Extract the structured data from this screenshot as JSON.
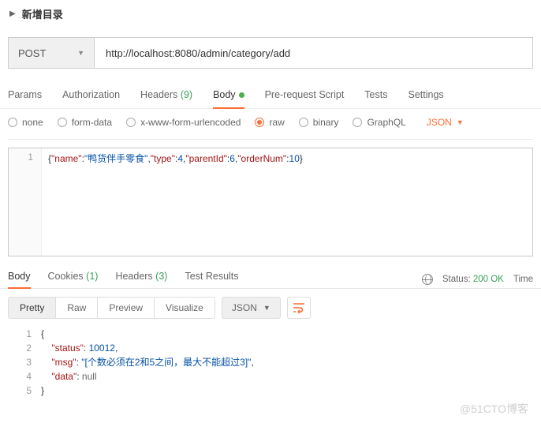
{
  "collapse": {
    "title": "新增目录"
  },
  "req": {
    "method": "POST",
    "url": "http://localhost:8080/admin/category/add"
  },
  "tabs": {
    "params": "Params",
    "auth": "Authorization",
    "headers_label": "Headers",
    "headers_count": "(9)",
    "body": "Body",
    "prereq": "Pre-request Script",
    "tests": "Tests",
    "settings": "Settings"
  },
  "bodytype": {
    "none": "none",
    "formdata": "form-data",
    "xwww": "x-www-form-urlencoded",
    "raw": "raw",
    "binary": "binary",
    "graphql": "GraphQL",
    "json": "JSON"
  },
  "reqbody": {
    "line_no": "1",
    "k_name": "\"name\"",
    "v_name": "\"鸭货伴手零食\"",
    "k_type": "\"type\"",
    "v_type": "4",
    "k_parent": "\"parentId\"",
    "v_parent": "6",
    "k_order": "\"orderNum\"",
    "v_order": "10"
  },
  "resptabs": {
    "body": "Body",
    "cookies_label": "Cookies",
    "cookies_count": "(1)",
    "headers_label": "Headers",
    "headers_count": "(3)",
    "tests": "Test Results"
  },
  "status": {
    "label": "Status:",
    "code": "200 OK",
    "time": "Time"
  },
  "views": {
    "pretty": "Pretty",
    "raw": "Raw",
    "preview": "Preview",
    "visualize": "Visualize",
    "json": "JSON"
  },
  "respbody": {
    "l1": "1",
    "l2": "2",
    "l3": "3",
    "l4": "4",
    "l5": "5",
    "k_status": "\"status\"",
    "v_status": "10012",
    "k_msg": "\"msg\"",
    "v_msg": "\"[个数必须在2和5之间，最大不能超过3]\"",
    "k_data": "\"data\"",
    "v_data": "null"
  },
  "watermark": "@51CTO博客"
}
